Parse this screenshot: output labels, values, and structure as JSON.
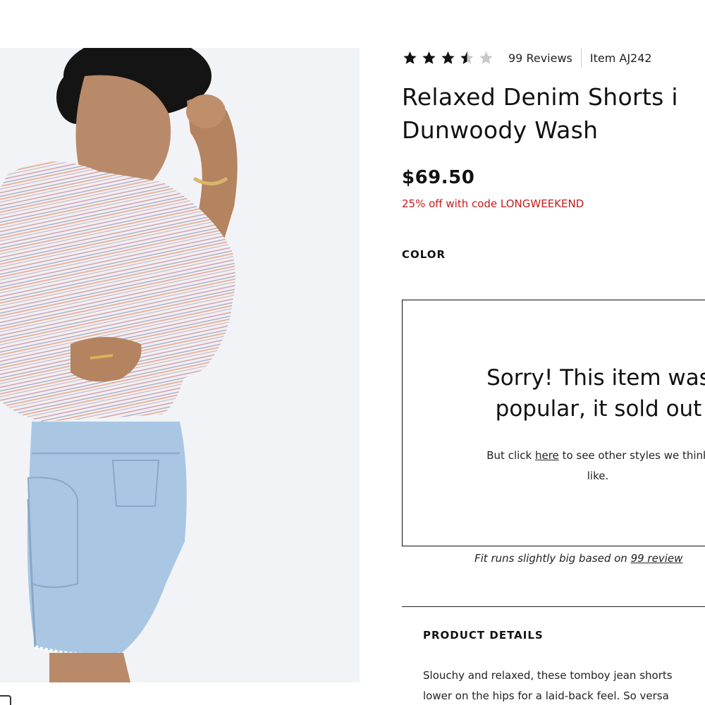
{
  "product": {
    "rating": {
      "value": 3.5,
      "max": 5,
      "reviews_label": "99 Reviews"
    },
    "item_number": "Item AJ242",
    "title_line1": "Relaxed Denim Shorts i",
    "title_line2": "Dunwoody Wash",
    "price": "$69.50",
    "promo": "25% off with code LONGWEEKEND",
    "color_label": "COLOR"
  },
  "soldout": {
    "heading_line1": "Sorry! This item was",
    "heading_line2": "popular, it sold out",
    "body_prefix": "But click ",
    "body_link": "here",
    "body_suffix": " to see other styles we think",
    "body_line2": "like."
  },
  "fit": {
    "prefix": "Fit runs slightly big based on ",
    "link": "99 review"
  },
  "details": {
    "heading": "PRODUCT DETAILS",
    "line1": "Slouchy and relaxed, these tomboy jean shorts",
    "line2": "lower on the hips for a laid-back feel. So versa"
  },
  "colors": {
    "promo_red": "#c41a1a",
    "star_fill": "#111111",
    "star_empty": "#c8c8c8",
    "image_bg": "#f2f3f6",
    "denim": "#a9c7e3"
  }
}
